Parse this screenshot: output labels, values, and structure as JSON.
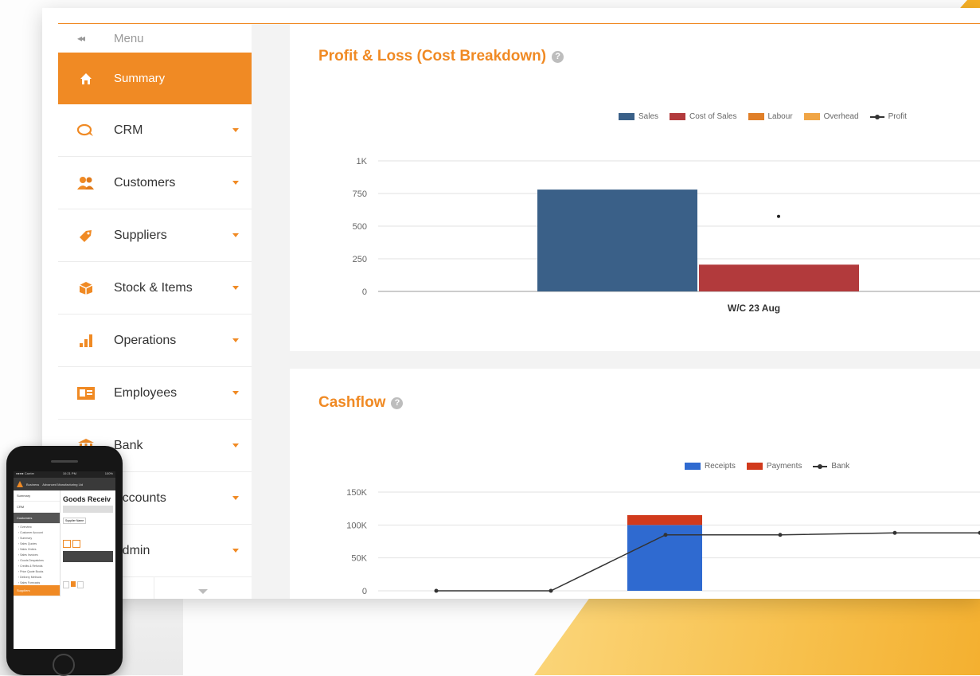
{
  "sidebar": {
    "menu_label": "Menu",
    "collapse_glyph": "◂◂",
    "items": [
      {
        "label": "Summary",
        "icon": "home-icon",
        "active": true
      },
      {
        "label": "CRM",
        "icon": "chat-icon"
      },
      {
        "label": "Customers",
        "icon": "customers-icon"
      },
      {
        "label": "Suppliers",
        "icon": "tag-icon"
      },
      {
        "label": "Stock & Items",
        "icon": "box-icon"
      },
      {
        "label": "Operations",
        "icon": "bar-chart-icon"
      },
      {
        "label": "Employees",
        "icon": "id-card-icon"
      },
      {
        "label": "Bank",
        "icon": "bank-icon"
      },
      {
        "label": "Accounts",
        "icon": "accounts-icon"
      },
      {
        "label": "Admin",
        "icon": "admin-icon"
      }
    ]
  },
  "colors": {
    "accent": "#f08a24",
    "sales": "#3a6088",
    "cost_of_sales": "#b23a3c",
    "labour": "#e07f28",
    "overhead": "#f0a545",
    "receipts": "#2f6ad0",
    "payments": "#d13a1c"
  },
  "profit_loss": {
    "title": "Profit & Loss (Cost Breakdown)",
    "help": "?",
    "legend": [
      "Sales",
      "Cost of Sales",
      "Labour",
      "Overhead",
      "Profit"
    ]
  },
  "cashflow": {
    "title": "Cashflow",
    "help": "?",
    "legend": [
      "Receipts",
      "Payments",
      "Bank"
    ]
  },
  "chart_data": [
    {
      "type": "bar",
      "title": "Profit & Loss (Cost Breakdown)",
      "categories": [
        "W/C 23 Aug"
      ],
      "yticks": [
        "0",
        "250",
        "500",
        "750",
        "1K"
      ],
      "ylim": [
        0,
        1000
      ],
      "series": [
        {
          "name": "Sales",
          "values": [
            780
          ]
        },
        {
          "name": "Cost of Sales",
          "values": [
            205
          ]
        },
        {
          "name": "Labour",
          "values": [
            0
          ]
        },
        {
          "name": "Overhead",
          "values": [
            0
          ]
        },
        {
          "name": "Profit",
          "type": "line",
          "values": [
            575
          ]
        }
      ],
      "legend": "top"
    },
    {
      "type": "bar",
      "title": "Cashflow",
      "yticks": [
        "0",
        "50K",
        "100K",
        "150K"
      ],
      "ylim": [
        0,
        150000
      ],
      "stacked_bar": {
        "x_index": 2,
        "receipts": 100000,
        "payments": 15000
      },
      "series": [
        {
          "name": "Receipts",
          "values": [
            0,
            0,
            100000,
            0,
            0,
            0
          ]
        },
        {
          "name": "Payments",
          "values": [
            0,
            0,
            15000,
            0,
            0,
            0
          ]
        },
        {
          "name": "Bank",
          "type": "line",
          "values": [
            0,
            0,
            85000,
            85000,
            88000,
            88000
          ]
        }
      ],
      "legend": "top"
    }
  ],
  "phone": {
    "status_left": "●●●● Carrier",
    "status_time": "10:21 PM",
    "status_right": "100%",
    "app_name": "Business",
    "company": "Advanced Manufacturing Ltd",
    "page_title": "Goods Receiv",
    "filter_label": "Supplier Name",
    "nav": [
      "Summary",
      "CRM",
      "Customers"
    ],
    "subitems": [
      "Overview",
      "Customer Account",
      "Summary",
      "Sales Quotes",
      "Sales Orders",
      "Sales Invoices",
      "Goods Despatches",
      "Credits & Refunds",
      "Price Quote Books",
      "Delivery Methods",
      "Sales Forecasts"
    ],
    "bottom_nav": "Suppliers"
  }
}
